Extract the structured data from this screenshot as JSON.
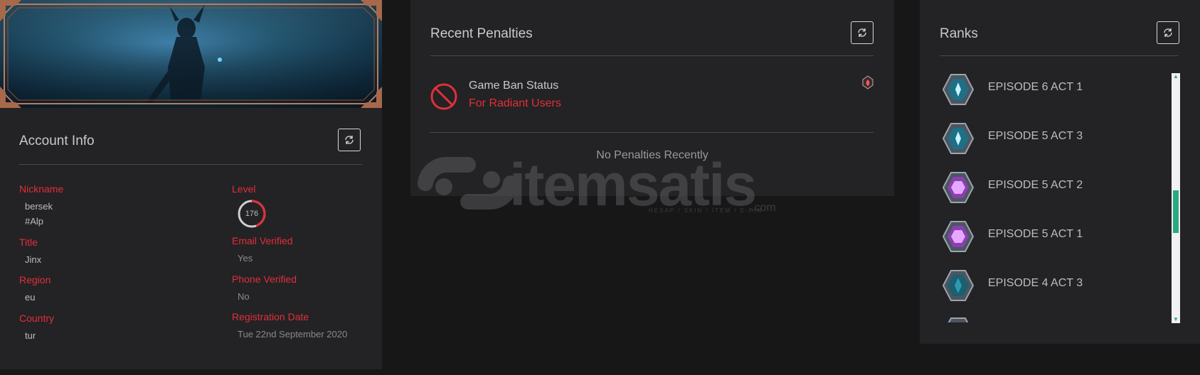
{
  "account": {
    "title": "Account Info",
    "labels": {
      "nickname": "Nickname",
      "level": "Level",
      "title": "Title",
      "email": "Email Verified",
      "region": "Region",
      "phone": "Phone Verified",
      "country": "Country",
      "registration": "Registration Date"
    },
    "values": {
      "nickname": "bersek",
      "tag": "#Alp",
      "level": "176",
      "title": "Jinx",
      "email": "Yes",
      "region": "eu",
      "phone": "No",
      "country": "tur",
      "registration": "Tue 22nd September 2020"
    }
  },
  "penalties": {
    "title": "Recent Penalties",
    "ban_title": "Game Ban Status",
    "ban_subtitle": "For Radiant Users",
    "empty_text": "No Penalties Recently"
  },
  "ranks": {
    "title": "Ranks",
    "items": [
      {
        "name": "EPISODE 6 ACT 1",
        "icon": "diamond-rank-icon",
        "color": "#3aa9c8"
      },
      {
        "name": "EPISODE 5 ACT 3",
        "icon": "diamond-rank-icon",
        "color": "#3aa9c8"
      },
      {
        "name": "EPISODE 5 ACT 2",
        "icon": "ascendant-rank-icon",
        "color": "#b563d8"
      },
      {
        "name": "EPISODE 5 ACT 1",
        "icon": "ascendant-rank-icon",
        "color": "#b563d8"
      },
      {
        "name": "EPISODE 4 ACT 3",
        "icon": "platinum-rank-icon",
        "color": "#2d8aa0"
      }
    ]
  },
  "watermark": {
    "brand": "itemsatis",
    "tagline": "HESAP / SKIN / ITEM / E-PIN",
    "suffix": ".com"
  },
  "colors": {
    "accent_red": "#e0303a",
    "scroll_accent": "#2aa882"
  }
}
